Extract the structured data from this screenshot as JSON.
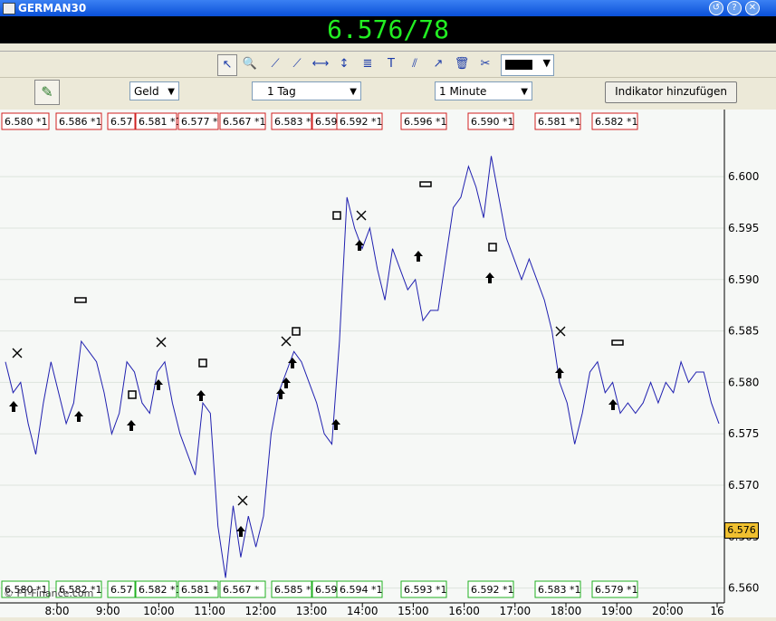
{
  "window": {
    "title": "GERMAN30"
  },
  "quote": {
    "text": "6.576/78"
  },
  "toolbar": {
    "tools": [
      "pointer-icon",
      "zoom-icon",
      "line-icon",
      "ray-icon",
      "hline-icon",
      "vline-icon",
      "fib-icon",
      "text-icon",
      "channel-icon",
      "arrow-icon",
      "trash-icon",
      "settings-icon"
    ],
    "color": "#000000"
  },
  "options": {
    "price_type": "Geld",
    "period": "1 Tag",
    "interval": "1 Minute",
    "indicator_button": "Indikator hinzufügen"
  },
  "colors": {
    "series": "#2020b0",
    "grid": "#dde4dd",
    "box_red": "#d02020",
    "box_green": "#20b020",
    "current_bg": "#f0c030"
  },
  "chart_data": {
    "type": "line",
    "ylim": [
      6.559,
      6.606
    ],
    "y_ticks": [
      "6.600",
      "6.595",
      "6.590",
      "6.585",
      "6.580",
      "6.575",
      "6.570",
      "6.565",
      "6.560"
    ],
    "x_ticks": [
      "8:00",
      "9:00",
      "10:00",
      "11:00",
      "12:00",
      "13:00",
      "14:00",
      "15:00",
      "16:00",
      "17:00",
      "18:00",
      "19:00",
      "20:00",
      "16"
    ],
    "current_price": "6.576",
    "watermark": "© FT-Finance.com",
    "top_labels": [
      "6.580 *1",
      "6.586 *1",
      "6.57",
      "6.581 *1",
      "6.577 *",
      "6.567 *1",
      "6.583 *",
      "6.59",
      "6.592 *1",
      "6.596 *1",
      "6.590 *1",
      "6.581 *1",
      "6.582 *1"
    ],
    "bottom_labels": [
      "6.580 *1",
      "6.582 *1",
      "6.57",
      "6.582 *1",
      "6.581 *",
      "6.567 *",
      "6.585 *1",
      "6.59",
      "6.594 *1",
      "6.593 *1",
      "6.592 *1",
      "6.583 *1",
      "6.579 *1"
    ],
    "series": [
      {
        "values": [
          6.582,
          6.579,
          6.58,
          6.576,
          6.573,
          6.578,
          6.582,
          6.579,
          6.576,
          6.578,
          6.584,
          6.583,
          6.582,
          6.579,
          6.575,
          6.577,
          6.582,
          6.581,
          6.578,
          6.577,
          6.581,
          6.582,
          6.578,
          6.575,
          6.573,
          6.571,
          6.578,
          6.577,
          6.566,
          6.561,
          6.568,
          6.563,
          6.567,
          6.564,
          6.567,
          6.575,
          6.579,
          6.581,
          6.583,
          6.582,
          6.58,
          6.578,
          6.575,
          6.574,
          6.584,
          6.598,
          6.595,
          6.593,
          6.595,
          6.591,
          6.588,
          6.593,
          6.591,
          6.589,
          6.59,
          6.586,
          6.587,
          6.587,
          6.592,
          6.597,
          6.598,
          6.601,
          6.599,
          6.596,
          6.602,
          6.598,
          6.594,
          6.592,
          6.59,
          6.592,
          6.59,
          6.588,
          6.585,
          6.58,
          6.578,
          6.574,
          6.577,
          6.581,
          6.582,
          6.579,
          6.58,
          6.577,
          6.578,
          6.577,
          6.578,
          6.58,
          6.578,
          6.58,
          6.579,
          6.582,
          6.58,
          6.581,
          6.581,
          6.578,
          6.576
        ]
      }
    ]
  }
}
